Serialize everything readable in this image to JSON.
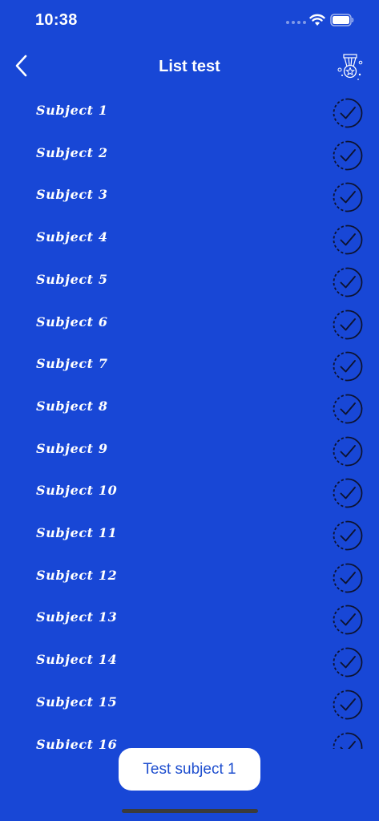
{
  "status_bar": {
    "time": "10:38"
  },
  "nav": {
    "title": "List test",
    "back_icon": "chevron-left-icon",
    "award_icon": "medal-icon"
  },
  "list": {
    "items": [
      {
        "label": "Subject 1"
      },
      {
        "label": "Subject 2"
      },
      {
        "label": "Subject 3"
      },
      {
        "label": "Subject 4"
      },
      {
        "label": "Subject 5"
      },
      {
        "label": "Subject 6"
      },
      {
        "label": "Subject 7"
      },
      {
        "label": "Subject 8"
      },
      {
        "label": "Subject 9"
      },
      {
        "label": "Subject 10"
      },
      {
        "label": "Subject 11"
      },
      {
        "label": "Subject 12"
      },
      {
        "label": "Subject 13"
      },
      {
        "label": "Subject 14"
      },
      {
        "label": "Subject 15"
      },
      {
        "label": "Subject 16"
      }
    ],
    "item_icon": "dashed-circle-check-icon"
  },
  "bottom": {
    "button_label": "Test subject 1"
  },
  "colors": {
    "background": "#1847d6",
    "button_text": "#1f4fcf",
    "check_stroke": "#0d1330"
  }
}
